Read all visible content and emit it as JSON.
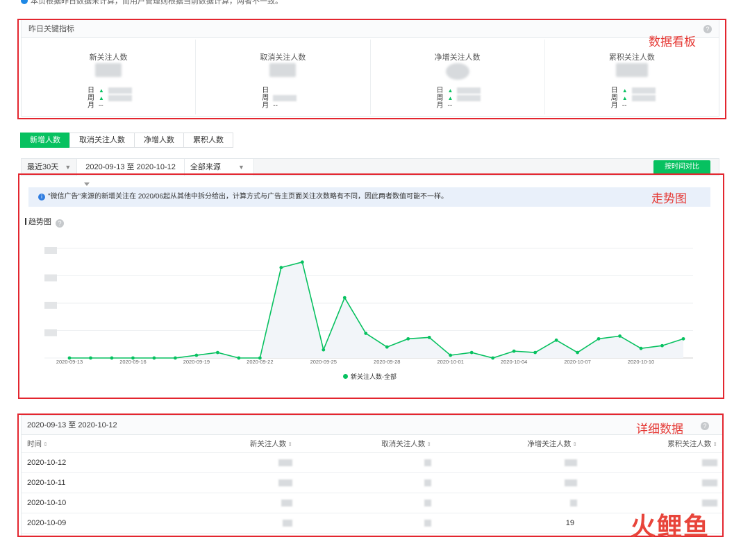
{
  "top_note": "本页根据昨日数据来计算，而用户管理则根据当前数据计算，两者不一致。",
  "kpi": {
    "title": "昨日关键指标",
    "annotation": "数据看板",
    "cards": [
      {
        "label": "新关注人数",
        "day": "日",
        "week": "周",
        "month": "月",
        "month_val": "--"
      },
      {
        "label": "取消关注人数",
        "day": "日",
        "week": "周",
        "month": "月",
        "month_val": "--"
      },
      {
        "label": "净增关注人数",
        "day": "日",
        "week": "周",
        "month": "月",
        "month_val": "--"
      },
      {
        "label": "累积关注人数",
        "day": "日",
        "week": "周",
        "month": "月",
        "month_val": "--"
      }
    ]
  },
  "tabs": [
    "新增人数",
    "取消关注人数",
    "净增人数",
    "累积人数"
  ],
  "filters": {
    "range": "最近30天",
    "dates": "2020-09-13 至 2020-10-12",
    "source": "全部来源",
    "compare": "按时间对比"
  },
  "notice": "\"微信广告\"来源的新增关注在 2020/06起从其他中拆分给出，计算方式与广告主页面关注次数略有不同，因此两者数值可能不一样。",
  "trend": {
    "annotation": "走势图",
    "title": "趋势图"
  },
  "chart_data": {
    "type": "line",
    "x_ticks": [
      "2020-09-13",
      "2020-09-16",
      "2020-09-19",
      "2020-09-22",
      "2020-09-25",
      "2020-09-28",
      "2020-10-01",
      "2020-10-04",
      "2020-10-07",
      "2020-10-10"
    ],
    "x": [
      "2020-09-13",
      "2020-09-14",
      "2020-09-15",
      "2020-09-16",
      "2020-09-17",
      "2020-09-18",
      "2020-09-19",
      "2020-09-20",
      "2020-09-21",
      "2020-09-22",
      "2020-09-23",
      "2020-09-24",
      "2020-09-25",
      "2020-09-26",
      "2020-09-27",
      "2020-09-28",
      "2020-09-29",
      "2020-09-30",
      "2020-10-01",
      "2020-10-02",
      "2020-10-03",
      "2020-10-04",
      "2020-10-05",
      "2020-10-06",
      "2020-10-07",
      "2020-10-08",
      "2020-10-09",
      "2020-10-10",
      "2020-10-11",
      "2020-10-12"
    ],
    "series": [
      {
        "name": "新关注人数-全部",
        "values": [
          0,
          0,
          0,
          0,
          0,
          0,
          1,
          2,
          0,
          0,
          33,
          35,
          3,
          22,
          9,
          4,
          7,
          7.5,
          1,
          2,
          0,
          2.5,
          2,
          6.5,
          2,
          7,
          8,
          3.5,
          4.5,
          7
        ]
      }
    ],
    "ylim": [
      0,
      40
    ],
    "color": "#07c160",
    "grid": true,
    "legend_position": "bottom"
  },
  "table": {
    "annotation": "详细数据",
    "range": "2020-09-13 至 2020-10-12",
    "columns": [
      "时间",
      "新关注人数",
      "取消关注人数",
      "净增关注人数",
      "累积关注人数"
    ],
    "rows": [
      {
        "date": "2020-10-12",
        "net": ""
      },
      {
        "date": "2020-10-11",
        "net": ""
      },
      {
        "date": "2020-10-10",
        "net": ""
      },
      {
        "date": "2020-10-09",
        "net": "19"
      }
    ]
  },
  "watermark": "火鲤鱼"
}
